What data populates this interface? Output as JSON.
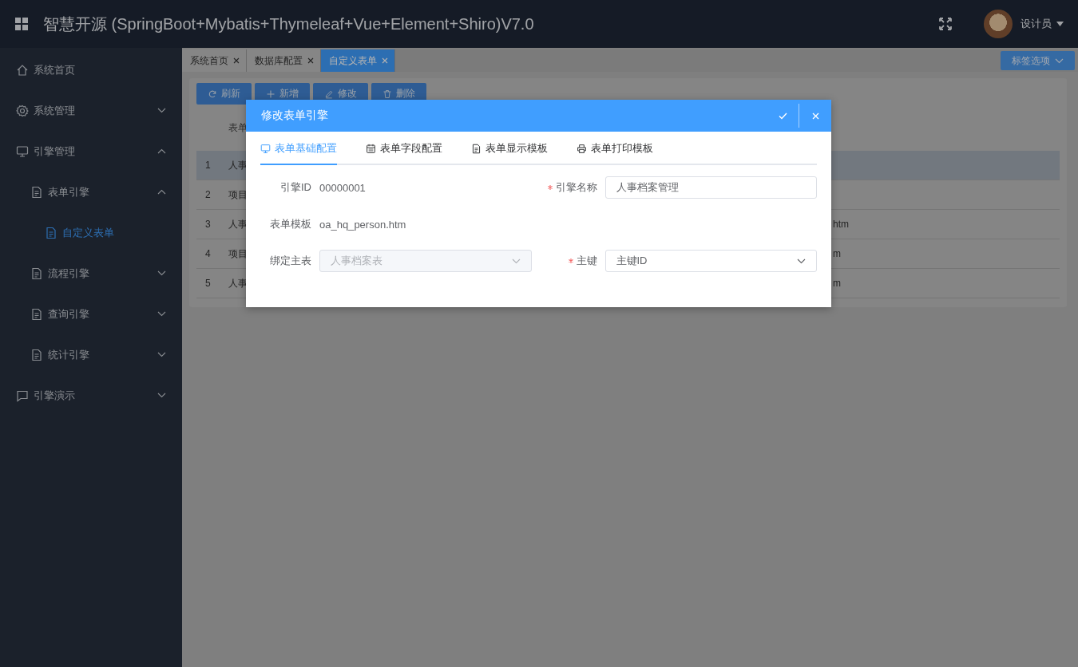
{
  "header": {
    "title": "智慧开源 (SpringBoot+Mybatis+Thymeleaf+Vue+Element+Shiro)V7.0",
    "user": "设计员"
  },
  "sidebar": {
    "items": [
      {
        "label": "系统首页",
        "kind": "link",
        "selected": false
      },
      {
        "label": "系统管理",
        "kind": "group",
        "expanded": false
      },
      {
        "label": "引擎管理",
        "kind": "group",
        "expanded": true,
        "children": [
          {
            "label": "表单引擎",
            "kind": "group",
            "expanded": true,
            "children": [
              {
                "label": "自定义表单",
                "kind": "link",
                "selected": true
              }
            ]
          },
          {
            "label": "流程引擎",
            "kind": "group",
            "expanded": false
          },
          {
            "label": "查询引擎",
            "kind": "group",
            "expanded": false
          },
          {
            "label": "统计引擎",
            "kind": "group",
            "expanded": false
          }
        ]
      },
      {
        "label": "引擎演示",
        "kind": "group",
        "expanded": false
      }
    ]
  },
  "tabs": [
    {
      "label": "系统首页",
      "selected": false
    },
    {
      "label": "数据库配置",
      "selected": false
    },
    {
      "label": "自定义表单",
      "selected": true
    }
  ],
  "tabs_menu": "标签选项",
  "toolbar": [
    {
      "label": "刷新"
    },
    {
      "label": "新增"
    },
    {
      "label": "修改"
    },
    {
      "label": "删除"
    }
  ],
  "table": {
    "column_2": "表单",
    "rows": [
      {
        "index": "1",
        "column_2": "人事",
        "selected": true
      },
      {
        "index": "2",
        "column_2": "项目",
        "selected": false
      },
      {
        "index": "3",
        "column_2": "人事",
        "column_3": "htm",
        "selected": false
      },
      {
        "index": "4",
        "column_2": "项目",
        "column_3": "m",
        "selected": false
      },
      {
        "index": "5",
        "column_2": "人事",
        "column_3": "m",
        "selected": false
      }
    ]
  },
  "dialog": {
    "title": "修改表单引擎",
    "tabs": [
      {
        "label": "表单基础配置",
        "selected": true
      },
      {
        "label": "表单字段配置",
        "selected": false
      },
      {
        "label": "表单显示模板",
        "selected": false
      },
      {
        "label": "表单打印模板",
        "selected": false
      }
    ],
    "fields": [
      {
        "label": "引擎ID",
        "value": "00000001",
        "kind": "text",
        "required": false
      },
      {
        "label": "引擎名称",
        "value": "人事档案管理",
        "kind": "input",
        "required": true,
        "disabled": false
      },
      {
        "label": "表单模板",
        "value": "oa_hq_person.htm",
        "kind": "text",
        "required": false
      },
      {
        "label": "绑定主表",
        "value": "人事档案表",
        "kind": "select",
        "required": false,
        "disabled": true
      },
      {
        "label": "主键",
        "value": "主键ID",
        "kind": "select",
        "required": true,
        "disabled": false
      }
    ]
  }
}
